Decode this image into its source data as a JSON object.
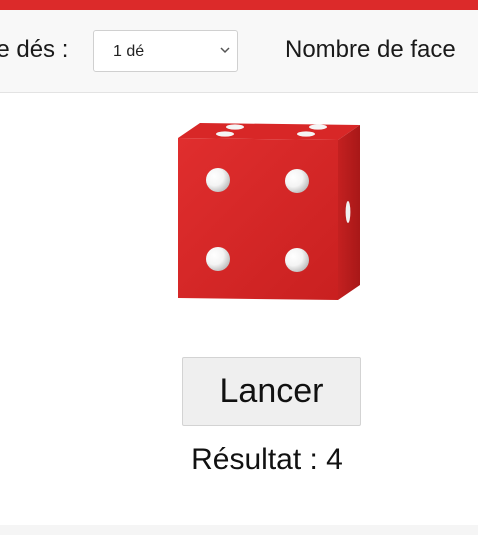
{
  "toolbar": {
    "dice_count_label": "le dés :",
    "dice_count_selected": "1 dé",
    "faces_label": "Nombre de face"
  },
  "die": {
    "front_face_value": 4,
    "color": "#dc2a2a"
  },
  "actions": {
    "roll_label": "Lancer"
  },
  "result": {
    "text": "Résultat : 4",
    "value": 4
  },
  "colors": {
    "accent": "#dc2a2a",
    "toolbar_bg": "#f8f8f8",
    "button_bg": "#efefef"
  }
}
